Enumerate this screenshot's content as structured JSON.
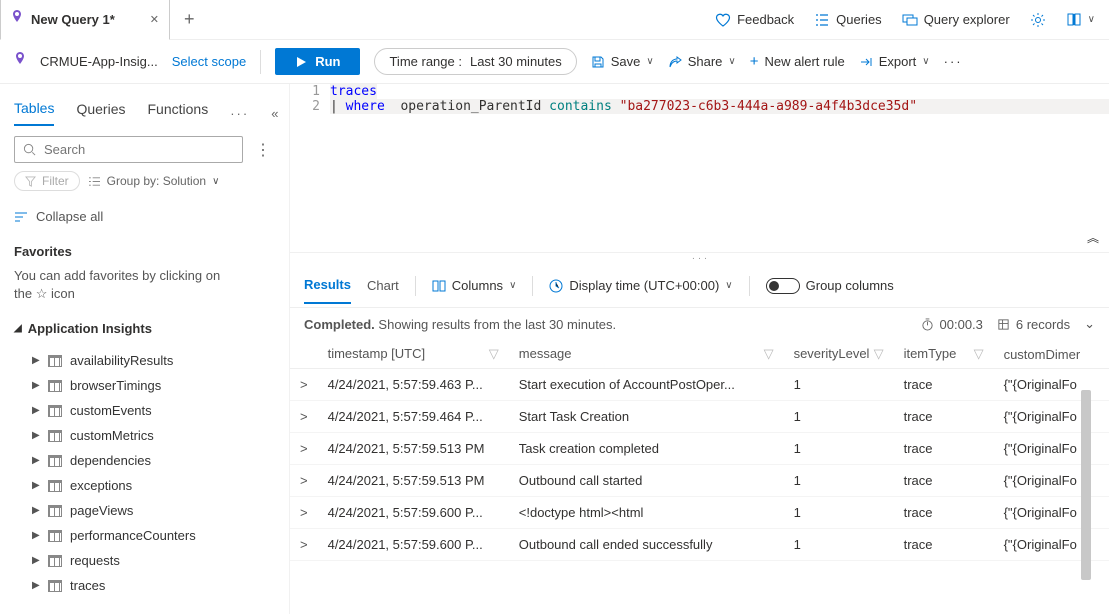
{
  "tab": {
    "title": "New Query 1*"
  },
  "top_links": {
    "feedback": "Feedback",
    "queries": "Queries",
    "query_explorer": "Query explorer"
  },
  "scope": {
    "resource": "CRMUE-App-Insig...",
    "select_scope": "Select scope"
  },
  "toolbar": {
    "run": "Run",
    "time_range_label": "Time range :",
    "time_range_value": "Last 30 minutes",
    "save": "Save",
    "share": "Share",
    "new_alert_rule": "New alert rule",
    "export": "Export"
  },
  "sidebar": {
    "tabs": {
      "tables": "Tables",
      "queries": "Queries",
      "functions": "Functions"
    },
    "search_placeholder": "Search",
    "filter": "Filter",
    "groupby": "Group by: Solution",
    "collapse_all": "Collapse all",
    "favorites": {
      "title": "Favorites",
      "text_a": "You can add favorites by clicking on",
      "text_b": "icon",
      "text_prefix": "the"
    },
    "category": "Application Insights",
    "tree": [
      "availabilityResults",
      "browserTimings",
      "customEvents",
      "customMetrics",
      "dependencies",
      "exceptions",
      "pageViews",
      "performanceCounters",
      "requests",
      "traces"
    ]
  },
  "editor": {
    "line1": "traces",
    "line2_pipe": "|",
    "line2_where": "where",
    "line2_field": "operation_ParentId",
    "line2_op": "contains",
    "line2_str": "\"ba277023-c6b3-444a-a989-a4f4b3dce35d\""
  },
  "results": {
    "tabs": {
      "results": "Results",
      "chart": "Chart"
    },
    "columns": "Columns",
    "display_time": "Display time (UTC+00:00)",
    "group_columns": "Group columns",
    "completed": "Completed.",
    "summary": "Showing results from the last 30 minutes.",
    "duration": "00:00.3",
    "record_count": "6 records",
    "headers": {
      "timestamp": "timestamp [UTC]",
      "message": "message",
      "severity": "severityLevel",
      "itemType": "itemType",
      "customDim": "customDimer"
    },
    "rows": [
      {
        "ts": "4/24/2021, 5:57:59.463 P...",
        "msg": "Start execution of AccountPostOper...",
        "sev": "1",
        "it": "trace",
        "cd": "{\"{OriginalFo"
      },
      {
        "ts": "4/24/2021, 5:57:59.464 P...",
        "msg": "Start Task Creation",
        "sev": "1",
        "it": "trace",
        "cd": "{\"{OriginalFo"
      },
      {
        "ts": "4/24/2021, 5:57:59.513 PM",
        "msg": "Task creation completed",
        "sev": "1",
        "it": "trace",
        "cd": "{\"{OriginalFo"
      },
      {
        "ts": "4/24/2021, 5:57:59.513 PM",
        "msg": "Outbound call started",
        "sev": "1",
        "it": "trace",
        "cd": "{\"{OriginalFo"
      },
      {
        "ts": "4/24/2021, 5:57:59.600 P...",
        "msg": "<!doctype html><html",
        "sev": "1",
        "it": "trace",
        "cd": "{\"{OriginalFo"
      },
      {
        "ts": "4/24/2021, 5:57:59.600 P...",
        "msg": "Outbound call ended successfully",
        "sev": "1",
        "it": "trace",
        "cd": "{\"{OriginalFo"
      }
    ]
  }
}
